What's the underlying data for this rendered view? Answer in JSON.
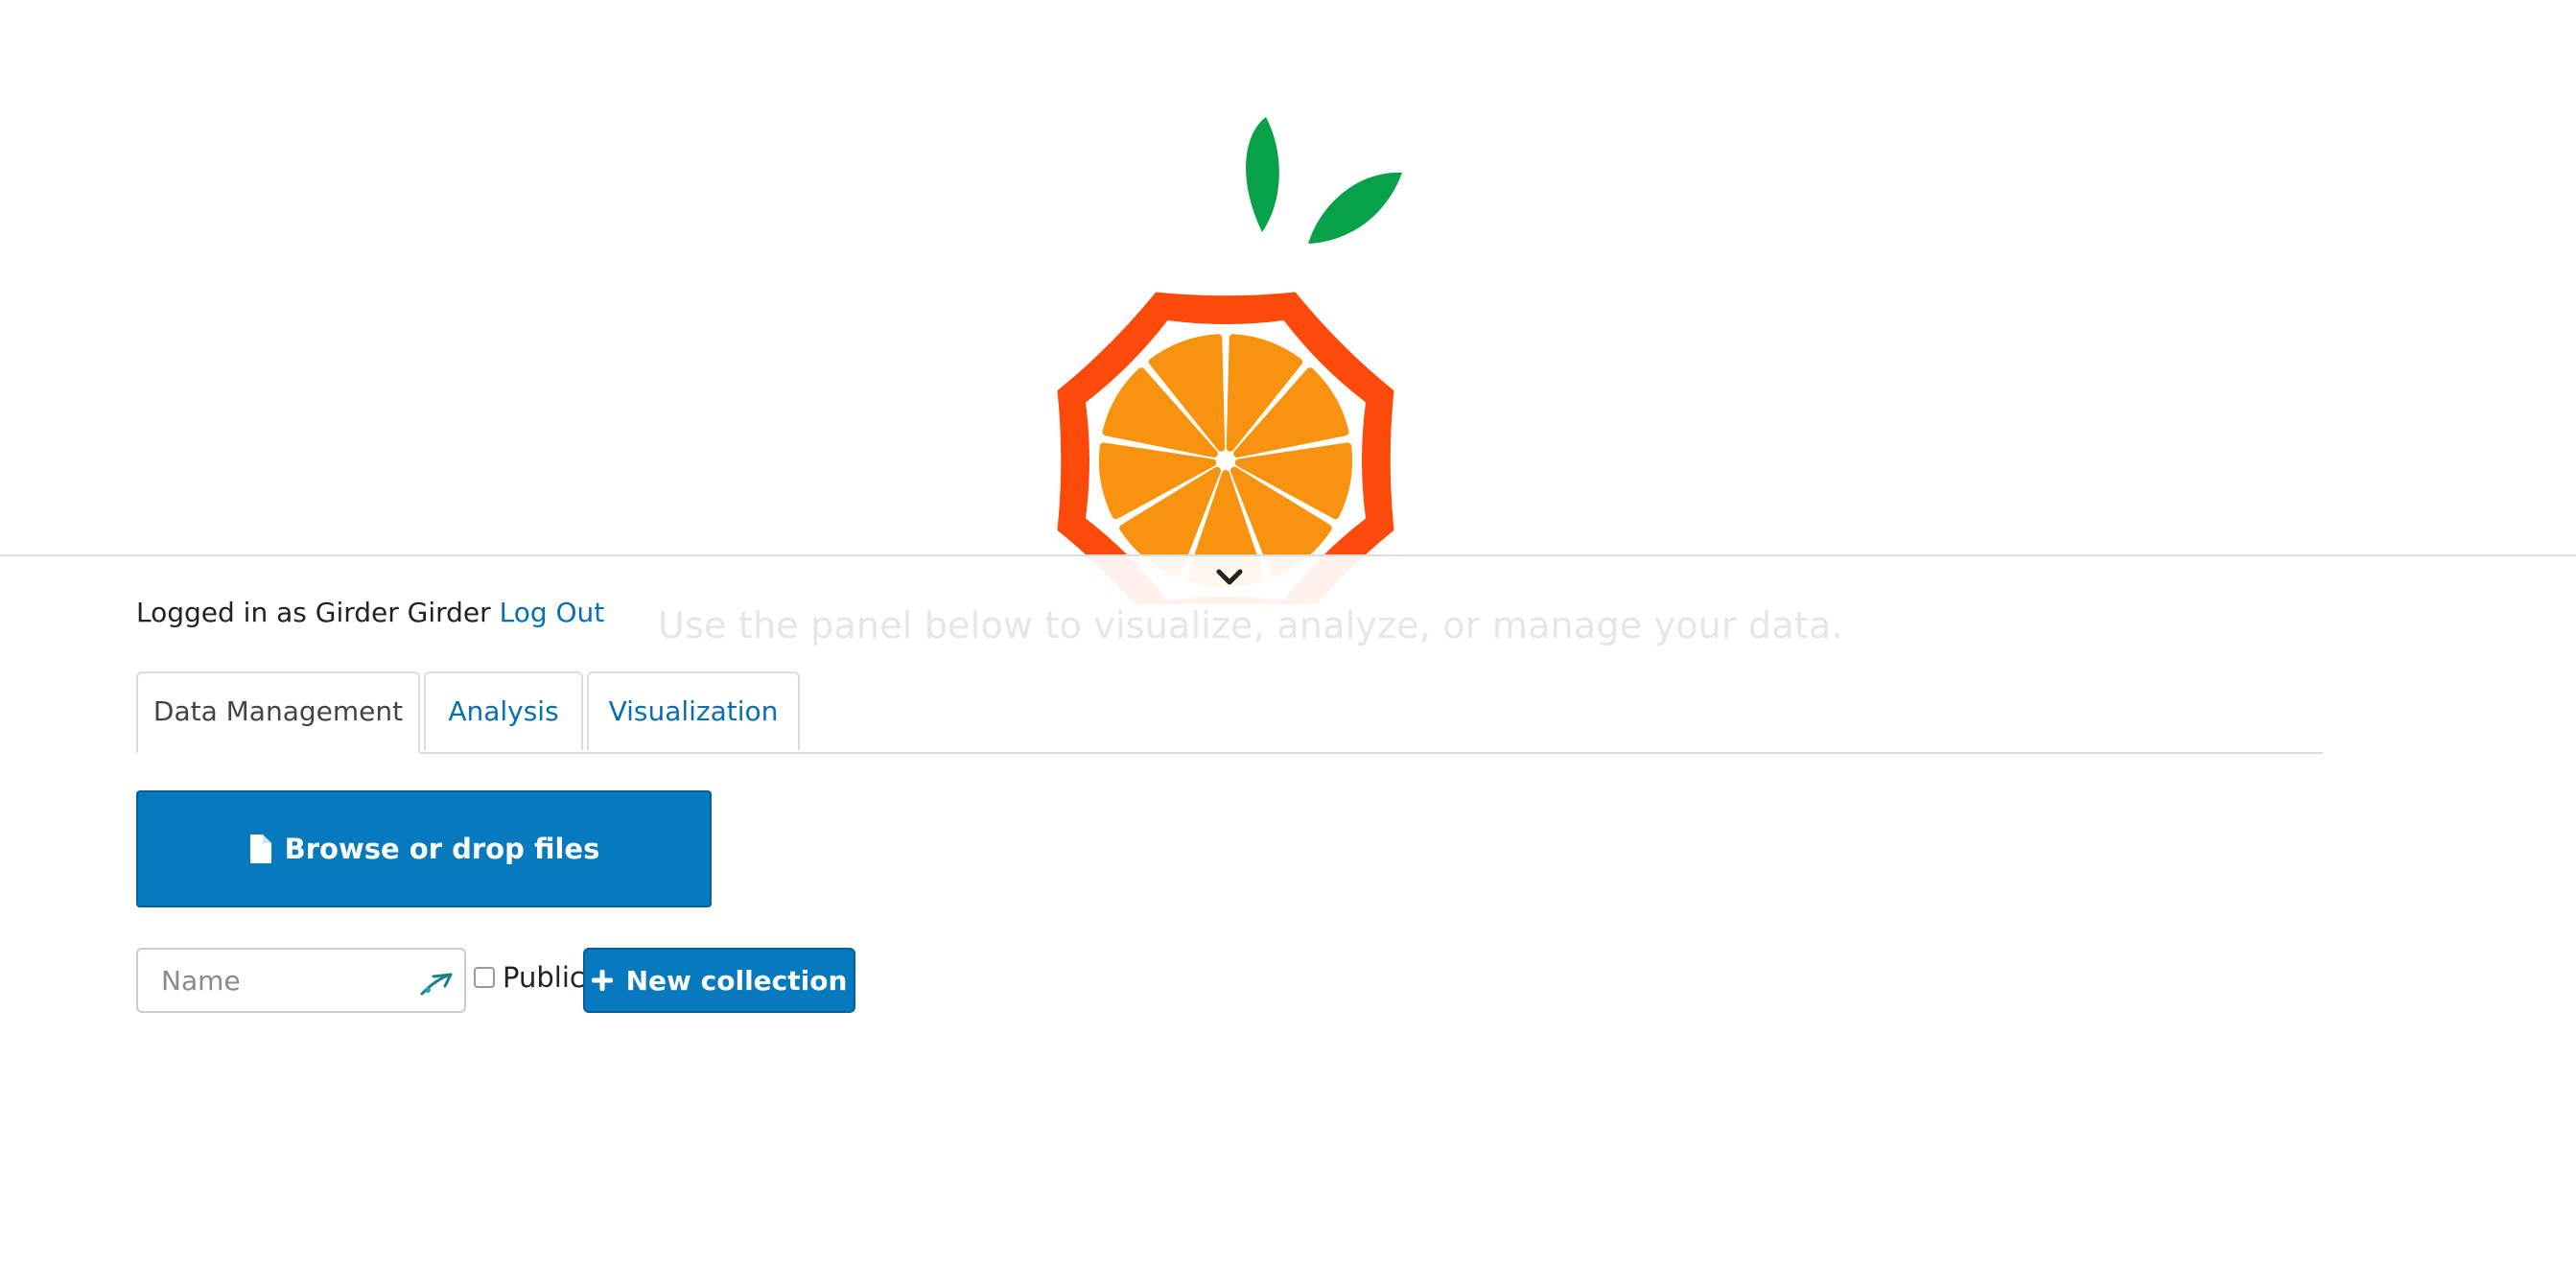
{
  "branding": {
    "logo": "orange-slice-logo",
    "colors": {
      "rind": "#fc4a0a",
      "pulp": "#f7930e",
      "leaf": "#07a14a"
    }
  },
  "panel": {
    "tagline": "Use the panel below to visualize, analyze, or manage your data.",
    "toggle_icon": "chevron-down-icon"
  },
  "auth": {
    "prefix": "Logged in as Girder Girder",
    "logout_label": "Log Out"
  },
  "tabs": [
    {
      "label": "Data Management",
      "active": true
    },
    {
      "label": "Analysis",
      "active": false
    },
    {
      "label": "Visualization",
      "active": false
    }
  ],
  "upload": {
    "icon": "file-icon",
    "label": "Browse or drop files"
  },
  "collection_form": {
    "name_placeholder": "Name",
    "name_value": "",
    "field_icon": "autofill-key-icon",
    "public_label": "Public",
    "public_checked": false,
    "button_icon": "plus-icon",
    "button_label": "New collection"
  },
  "theme": {
    "primary": "#077abf",
    "link": "#0a6eb4"
  }
}
